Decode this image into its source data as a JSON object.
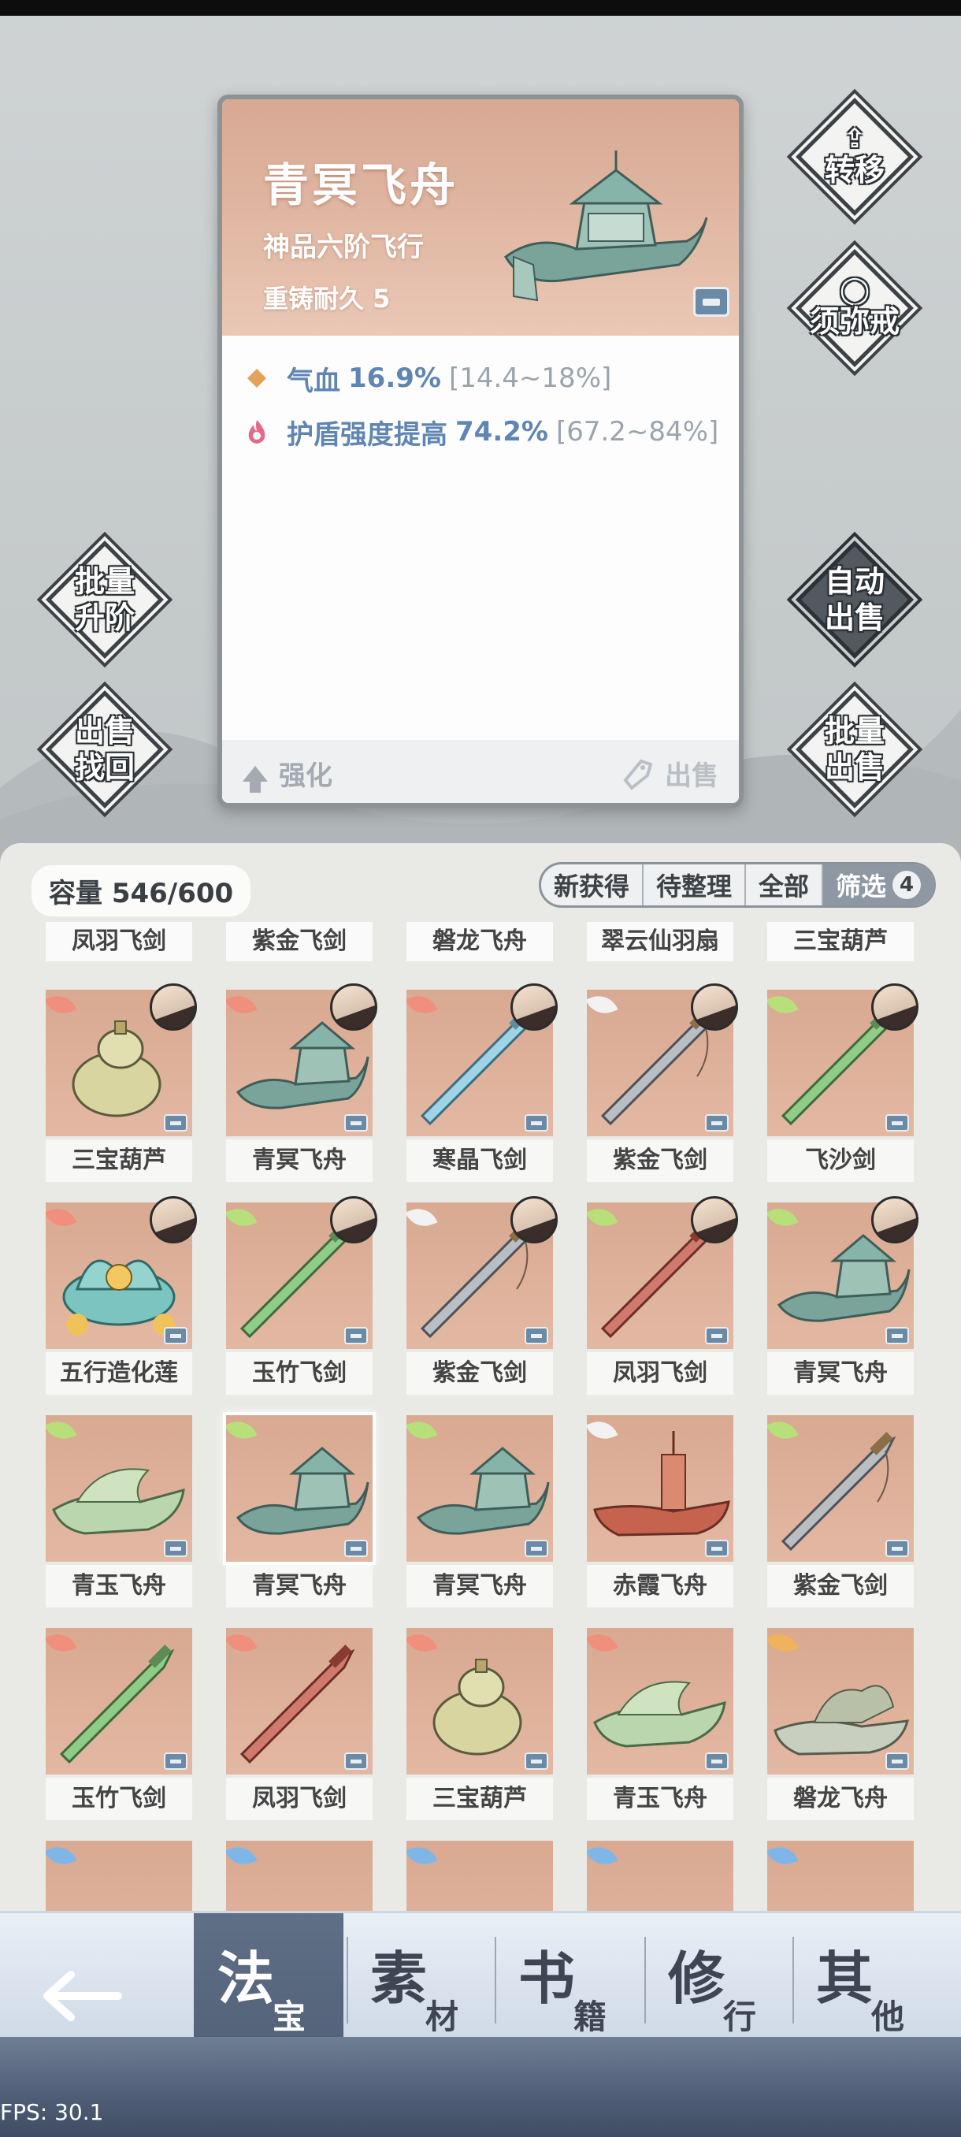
{
  "detail": {
    "title": "青冥飞舟",
    "subtitle": "神品六阶飞行",
    "durability": "重铸耐久 5",
    "stats": [
      {
        "icon": "diamond-icon",
        "name": "气血",
        "value": "16.9%",
        "range": "[14.4~18%]"
      },
      {
        "icon": "flame-shield-icon",
        "name": "护盾强度提高",
        "value": "74.2%",
        "range": "[67.2~84%]"
      }
    ],
    "enhance_label": "强化",
    "sell_label": "出售"
  },
  "side_buttons": {
    "transfer": "转移",
    "sumeru": "须弥戒",
    "batch_upgrade_1": "批量",
    "batch_upgrade_2": "升阶",
    "sell_recover_1": "出售",
    "sell_recover_2": "找回",
    "auto_sell_1": "自动",
    "auto_sell_2": "出售",
    "batch_sell_1": "批量",
    "batch_sell_2": "出售"
  },
  "inventory": {
    "capacity": "容量 546/600",
    "filters": [
      "新获得",
      "待整理",
      "全部",
      "筛选"
    ],
    "filter_count": "4",
    "header_labels": [
      "凤羽飞剑",
      "紫金飞剑",
      "磐龙飞舟",
      "翠云仙羽扇",
      "三宝葫芦"
    ],
    "rows": [
      [
        {
          "name": "三宝葫芦",
          "wing": "#ef8f7c",
          "type": "gourd",
          "avatar": true
        },
        {
          "name": "青冥飞舟",
          "wing": "#ef8f7c",
          "type": "boat",
          "avatar": true
        },
        {
          "name": "寒晶飞剑",
          "wing": "#ef8f7c",
          "type": "sword-ice",
          "avatar": true
        },
        {
          "name": "紫金飞剑",
          "wing": "#f2f2f2",
          "type": "sword-grey",
          "avatar": true
        },
        {
          "name": "飞沙剑",
          "wing": "#b7e07a",
          "type": "sword-green",
          "avatar": true
        }
      ],
      [
        {
          "name": "五行造化莲",
          "wing": "#ef8f7c",
          "type": "lotus",
          "avatar": true
        },
        {
          "name": "玉竹飞剑",
          "wing": "#b7e07a",
          "type": "sword-green",
          "avatar": true
        },
        {
          "name": "紫金飞剑",
          "wing": "#f2f2f2",
          "type": "sword-grey",
          "avatar": true
        },
        {
          "name": "凤羽飞剑",
          "wing": "#b7e07a",
          "type": "sword-red",
          "avatar": true
        },
        {
          "name": "青冥飞舟",
          "wing": "#b7e07a",
          "type": "boat",
          "avatar": true
        }
      ],
      [
        {
          "name": "青玉飞舟",
          "wing": "#b7e07a",
          "type": "boat-jade",
          "avatar": false
        },
        {
          "name": "青冥飞舟",
          "wing": "#b7e07a",
          "type": "boat",
          "avatar": false,
          "selected": true
        },
        {
          "name": "青冥飞舟",
          "wing": "#b7e07a",
          "type": "boat",
          "avatar": false
        },
        {
          "name": "赤霞飞舟",
          "wing": "#f2f2f2",
          "type": "boat-red",
          "avatar": false
        },
        {
          "name": "紫金飞剑",
          "wing": "#b7e07a",
          "type": "sword-grey",
          "avatar": false
        }
      ],
      [
        {
          "name": "玉竹飞剑",
          "wing": "#ef8f7c",
          "type": "sword-green",
          "avatar": false
        },
        {
          "name": "凤羽飞剑",
          "wing": "#ef8f7c",
          "type": "sword-red",
          "avatar": false
        },
        {
          "name": "三宝葫芦",
          "wing": "#ef8f7c",
          "type": "gourd",
          "avatar": false
        },
        {
          "name": "青玉飞舟",
          "wing": "#ef8f7c",
          "type": "boat-jade",
          "avatar": false
        },
        {
          "name": "磐龙飞舟",
          "wing": "#f0b25a",
          "type": "boat-dragon",
          "avatar": false
        }
      ]
    ],
    "partial_row_wings": [
      "#7fb6e8",
      "#7fb6e8",
      "#7fb6e8",
      "#7fb6e8",
      "#7fb6e8"
    ]
  },
  "nav": {
    "tabs": [
      {
        "big": "法",
        "small": "宝"
      },
      {
        "big": "素",
        "small": "材"
      },
      {
        "big": "书",
        "small": "籍"
      },
      {
        "big": "修",
        "small": "行"
      },
      {
        "big": "其",
        "small": "他"
      }
    ]
  },
  "fps": "FPS: 30.1"
}
